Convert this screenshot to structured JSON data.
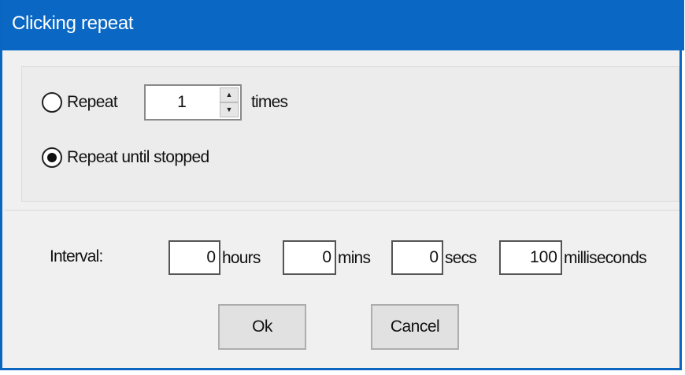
{
  "window": {
    "title": "Clicking repeat"
  },
  "repeat_options": {
    "repeat_label": "Repeat",
    "repeat_count": "1",
    "times_label": "times",
    "until_stopped_label": "Repeat until stopped",
    "selected": "until_stopped"
  },
  "interval": {
    "label": "Interval:",
    "hours_value": "0",
    "hours_label": "hours",
    "mins_value": "0",
    "mins_label": "mins",
    "secs_value": "0",
    "secs_label": "secs",
    "ms_value": "100",
    "ms_label": "milliseconds"
  },
  "buttons": {
    "ok": "Ok",
    "cancel": "Cancel"
  },
  "icons": {
    "spin_up": "up-arrow-icon",
    "spin_down": "down-arrow-icon"
  },
  "colors": {
    "titlebar": "#0a68c4",
    "border": "#0b66c2"
  }
}
